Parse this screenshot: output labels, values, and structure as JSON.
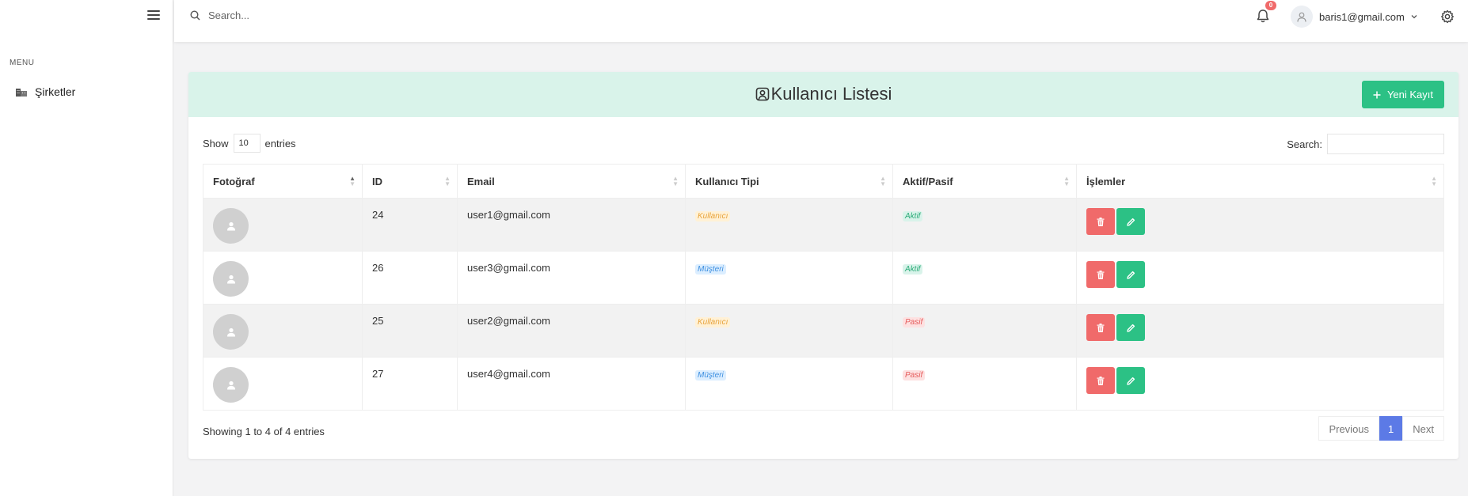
{
  "sidebar": {
    "menu_title": "MENU",
    "items": [
      {
        "label": "Şirketler",
        "icon": "building-icon"
      }
    ]
  },
  "topbar": {
    "search_placeholder": "Search...",
    "notification_count": "0",
    "user_email": "baris1@gmail.com"
  },
  "card": {
    "title": "Kullanıcı Listesi",
    "new_button": "Yeni Kayıt",
    "show_label": "Show",
    "entries_value": "10",
    "entries_label": "entries",
    "search_label": "Search:",
    "columns": [
      "Fotoğraf",
      "ID",
      "Email",
      "Kullanıcı Tipi",
      "Aktif/Pasif",
      "İşlemler"
    ],
    "rows": [
      {
        "id": "24",
        "email": "user1@gmail.com",
        "type": "Kullanıcı",
        "status": "Aktif"
      },
      {
        "id": "26",
        "email": "user3@gmail.com",
        "type": "Müşteri",
        "status": "Aktif"
      },
      {
        "id": "25",
        "email": "user2@gmail.com",
        "type": "Kullanıcı",
        "status": "Pasif"
      },
      {
        "id": "27",
        "email": "user4@gmail.com",
        "type": "Müşteri",
        "status": "Pasif"
      }
    ],
    "info": "Showing 1 to 4 of 4 entries",
    "pagination": {
      "previous": "Previous",
      "current": "1",
      "next": "Next"
    }
  },
  "colors": {
    "accent_green": "#2cc185",
    "danger_red": "#f06a6a",
    "primary_blue": "#5c7ae6",
    "header_mint": "#d9f3ea"
  }
}
